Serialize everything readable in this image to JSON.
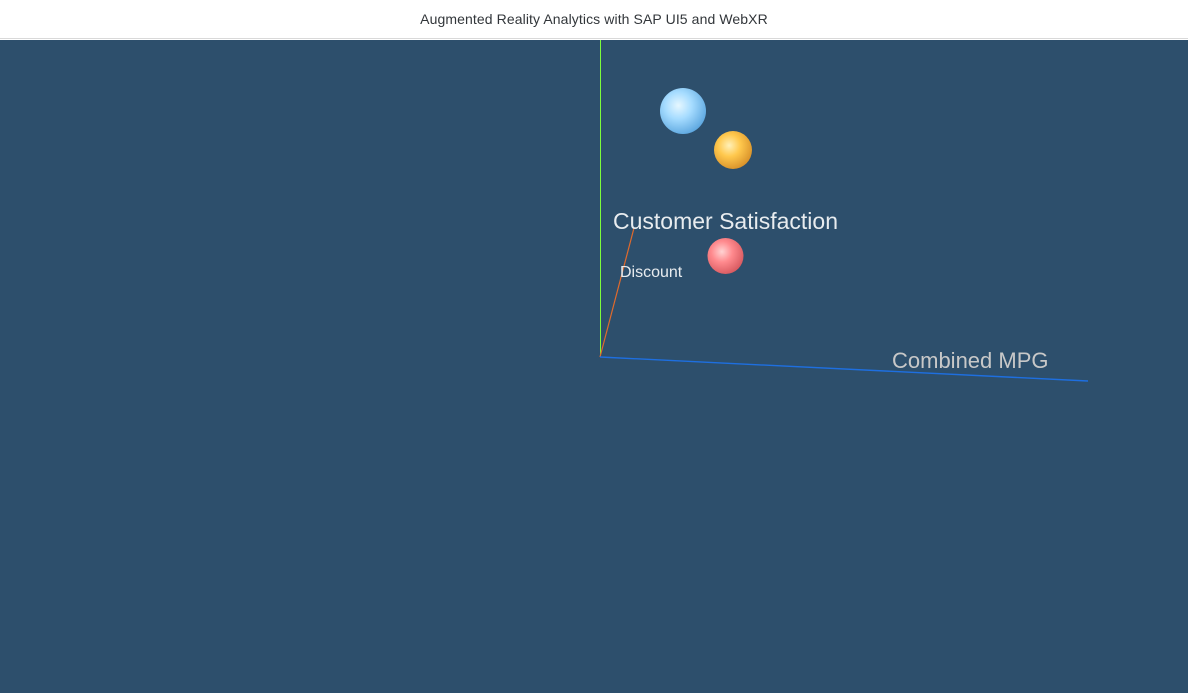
{
  "header": {
    "title": "Augmented Reality Analytics with SAP UI5 and WebXR"
  },
  "chart_data": {
    "type": "scatter",
    "title": "",
    "axes": {
      "y": {
        "label": "Customer Satisfaction",
        "color": "#7cfc3c"
      },
      "z": {
        "label": "Discount",
        "color": "#e06a2c"
      },
      "x": {
        "label": "Combined MPG",
        "color": "#1e6fe0"
      }
    },
    "series": [
      {
        "color": "#8fd3ff"
      },
      {
        "color": "#ffc24d"
      },
      {
        "color": "#ff7b80"
      }
    ]
  },
  "colors": {
    "background": "#2d4f6c",
    "header_bg": "#ffffff"
  }
}
